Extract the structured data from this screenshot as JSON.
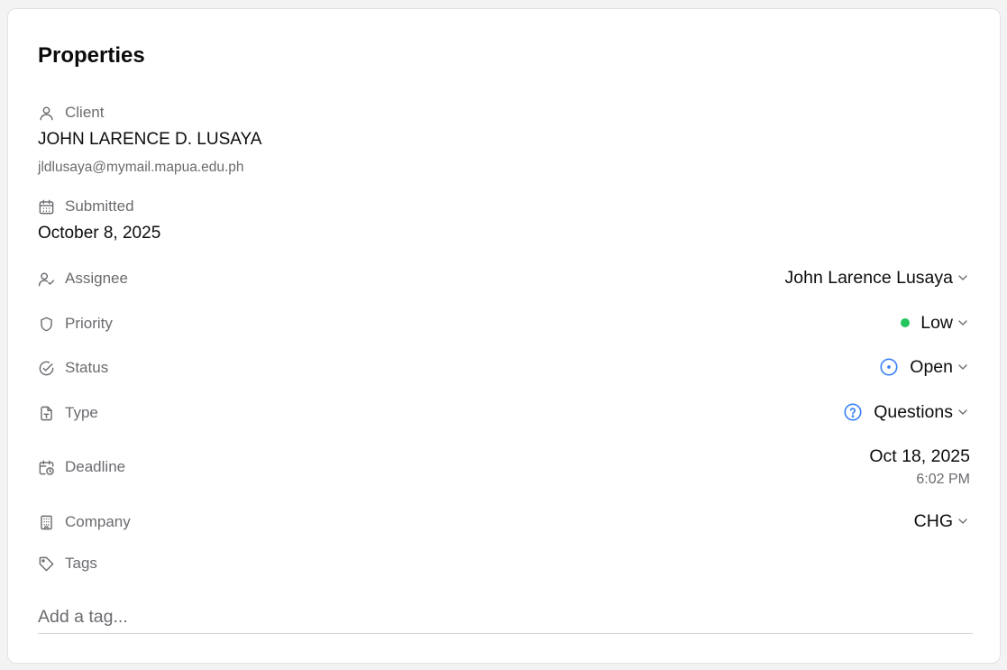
{
  "panel": {
    "title": "Properties"
  },
  "client": {
    "label": "Client",
    "icon": "user-icon",
    "name": "JOHN LARENCE D. LUSAYA",
    "email": "jldlusaya@mymail.mapua.edu.ph"
  },
  "submitted": {
    "label": "Submitted",
    "icon": "calendar-icon",
    "value": "October 8, 2025"
  },
  "assignee": {
    "label": "Assignee",
    "icon": "user-check-icon",
    "value": "John Larence Lusaya"
  },
  "priority": {
    "label": "Priority",
    "icon": "shield-icon",
    "value": "Low",
    "color": "#22c55e"
  },
  "status": {
    "label": "Status",
    "icon": "circle-check-icon",
    "value": "Open",
    "color": "#3b82f6"
  },
  "type": {
    "label": "Type",
    "icon": "file-type-icon",
    "value": "Questions",
    "color": "#3b82f6"
  },
  "deadline": {
    "label": "Deadline",
    "icon": "calendar-clock-icon",
    "date": "Oct 18, 2025",
    "time": "6:02 PM"
  },
  "company": {
    "label": "Company",
    "icon": "building-icon",
    "value": "CHG"
  },
  "tags": {
    "label": "Tags",
    "icon": "tag-icon",
    "placeholder": "Add a tag..."
  }
}
